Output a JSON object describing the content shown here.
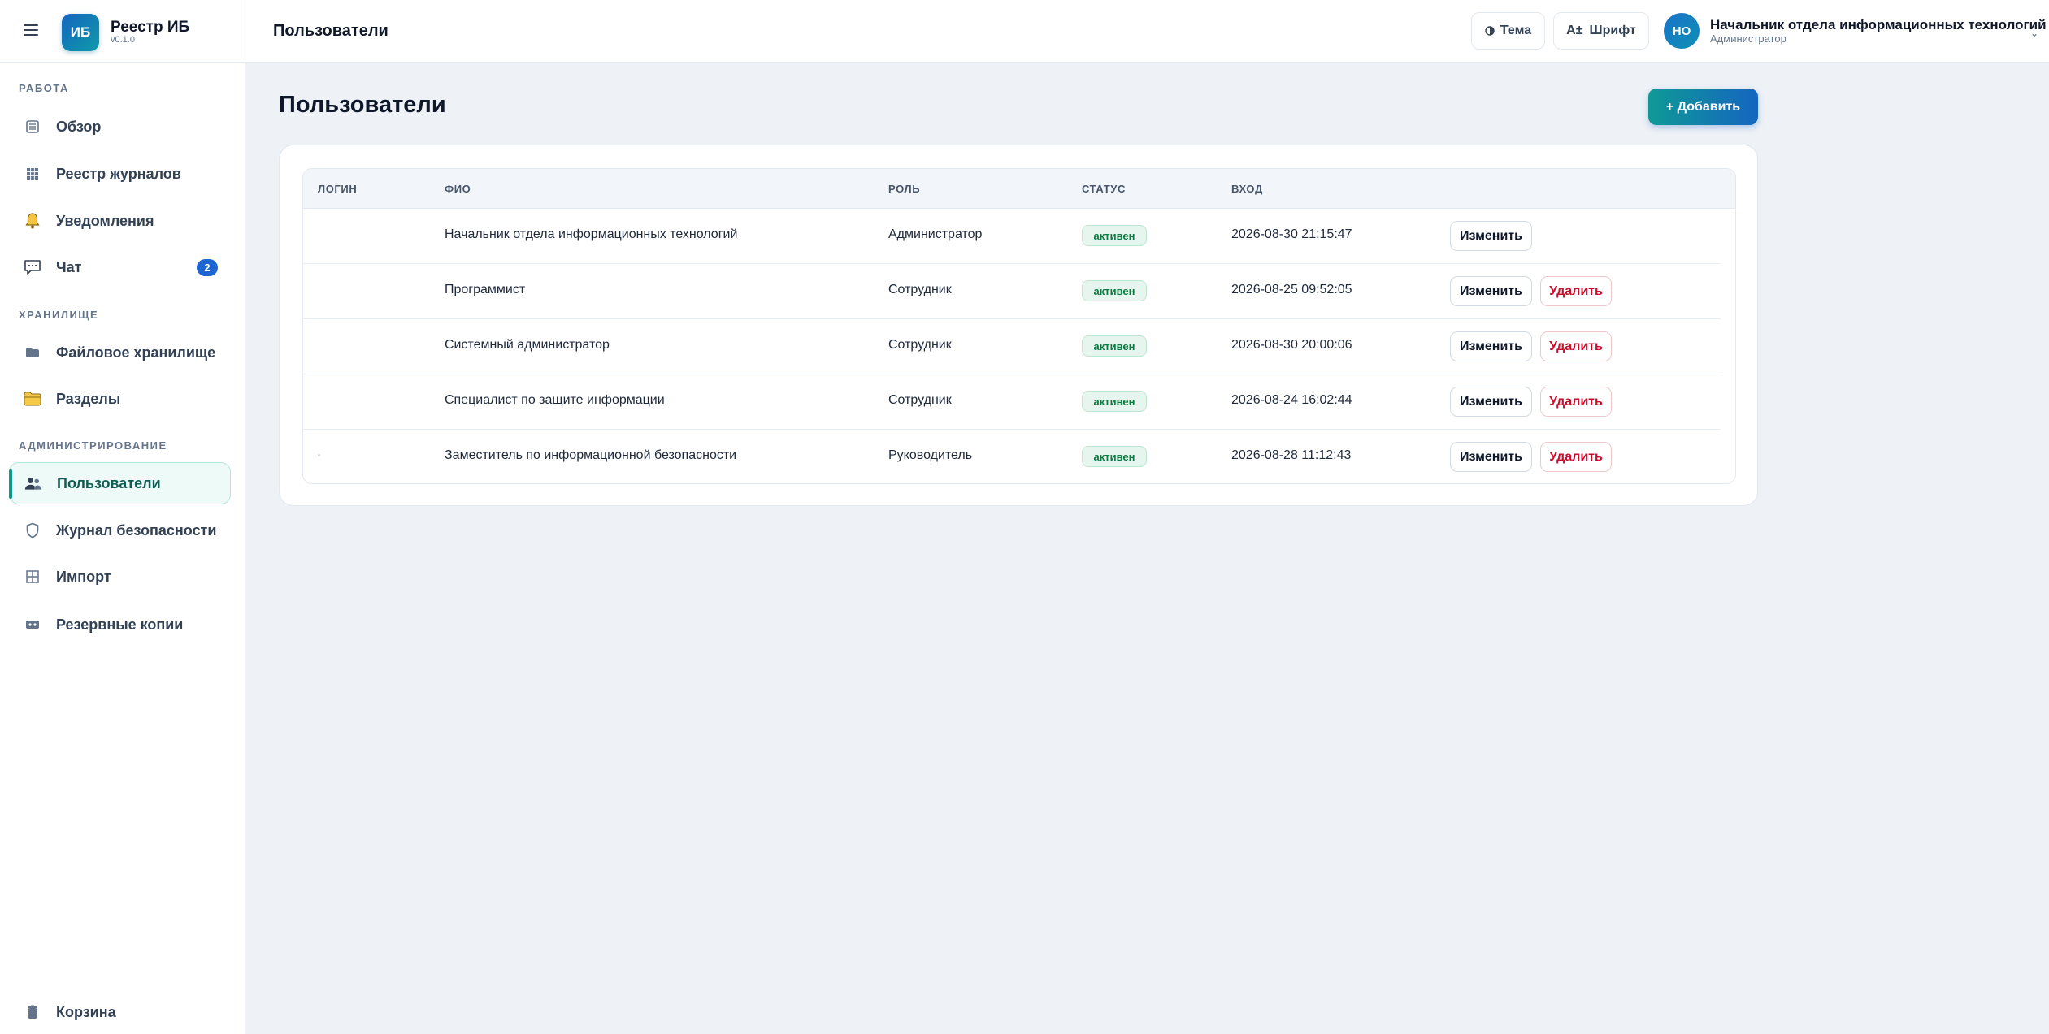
{
  "app": {
    "logo_text": "ИБ",
    "name": "Реестр ИБ",
    "version": "v0.1.0"
  },
  "sidebar": {
    "sections": {
      "work": "РАБОТА",
      "storage": "ХРАНИЛИЩЕ",
      "admin": "АДМИНИСТРИРОВАНИЕ"
    },
    "items": [
      {
        "label": "Обзор",
        "icon": "list-icon"
      },
      {
        "label": "Реестр журналов",
        "icon": "grid-icon"
      },
      {
        "label": "Уведомления",
        "icon": "bell-icon"
      },
      {
        "label": "Чат",
        "icon": "chat-icon",
        "badge": "2"
      },
      {
        "label": "Файловое хранилище",
        "icon": "storage-icon"
      },
      {
        "label": "Разделы",
        "icon": "folder-icon"
      },
      {
        "label": "Пользователи",
        "icon": "users-icon",
        "active": true
      },
      {
        "label": "Журнал безопасности",
        "icon": "shield-icon"
      },
      {
        "label": "Импорт",
        "icon": "import-icon"
      },
      {
        "label": "Резервные копии",
        "icon": "backup-icon"
      }
    ],
    "trash": {
      "label": "Корзина",
      "icon": "trash-icon"
    }
  },
  "header": {
    "title": "Пользователи",
    "theme_label": "Тема",
    "font_label": "Шрифт",
    "user": {
      "initials": "НО",
      "name": "Начальник отдела информационных технологий",
      "role": "Администратор"
    }
  },
  "main": {
    "title": "Пользователи",
    "add_label": "+ Добавить",
    "columns": [
      "ЛОГИН",
      "ФИО",
      "РОЛЬ",
      "СТАТУС",
      "ВХОД"
    ],
    "rows": [
      {
        "login": "",
        "name": "Начальник отдела информационных технологий",
        "role": "Администратор",
        "status": "активен",
        "last_login": "2026-08-30 21:15:47",
        "edit": "Изменить",
        "delete": ""
      },
      {
        "login": "",
        "name": "Программист",
        "role": "Сотрудник",
        "status": "активен",
        "last_login": "2026-08-25 09:52:05",
        "edit": "Изменить",
        "delete": "Удалить"
      },
      {
        "login": "",
        "name": "Системный администратор",
        "role": "Сотрудник",
        "status": "активен",
        "last_login": "2026-08-30 20:00:06",
        "edit": "Изменить",
        "delete": "Удалить"
      },
      {
        "login": "",
        "name": "Специалист по защите информации",
        "role": "Сотрудник",
        "status": "активен",
        "last_login": "2026-08-24 16:02:44",
        "edit": "Изменить",
        "delete": "Удалить"
      },
      {
        "login": "",
        "name": "Заместитель по информационной безопасности",
        "role": "Руководитель",
        "status": "активен",
        "last_login": "2026-08-28 11:12:43",
        "edit": "Изменить",
        "delete": "Удалить"
      }
    ]
  },
  "colors": {
    "accent": "#0e9a86",
    "brand": "#1565c0",
    "danger": "#c8102e",
    "status_ok": "#0b7a43"
  }
}
